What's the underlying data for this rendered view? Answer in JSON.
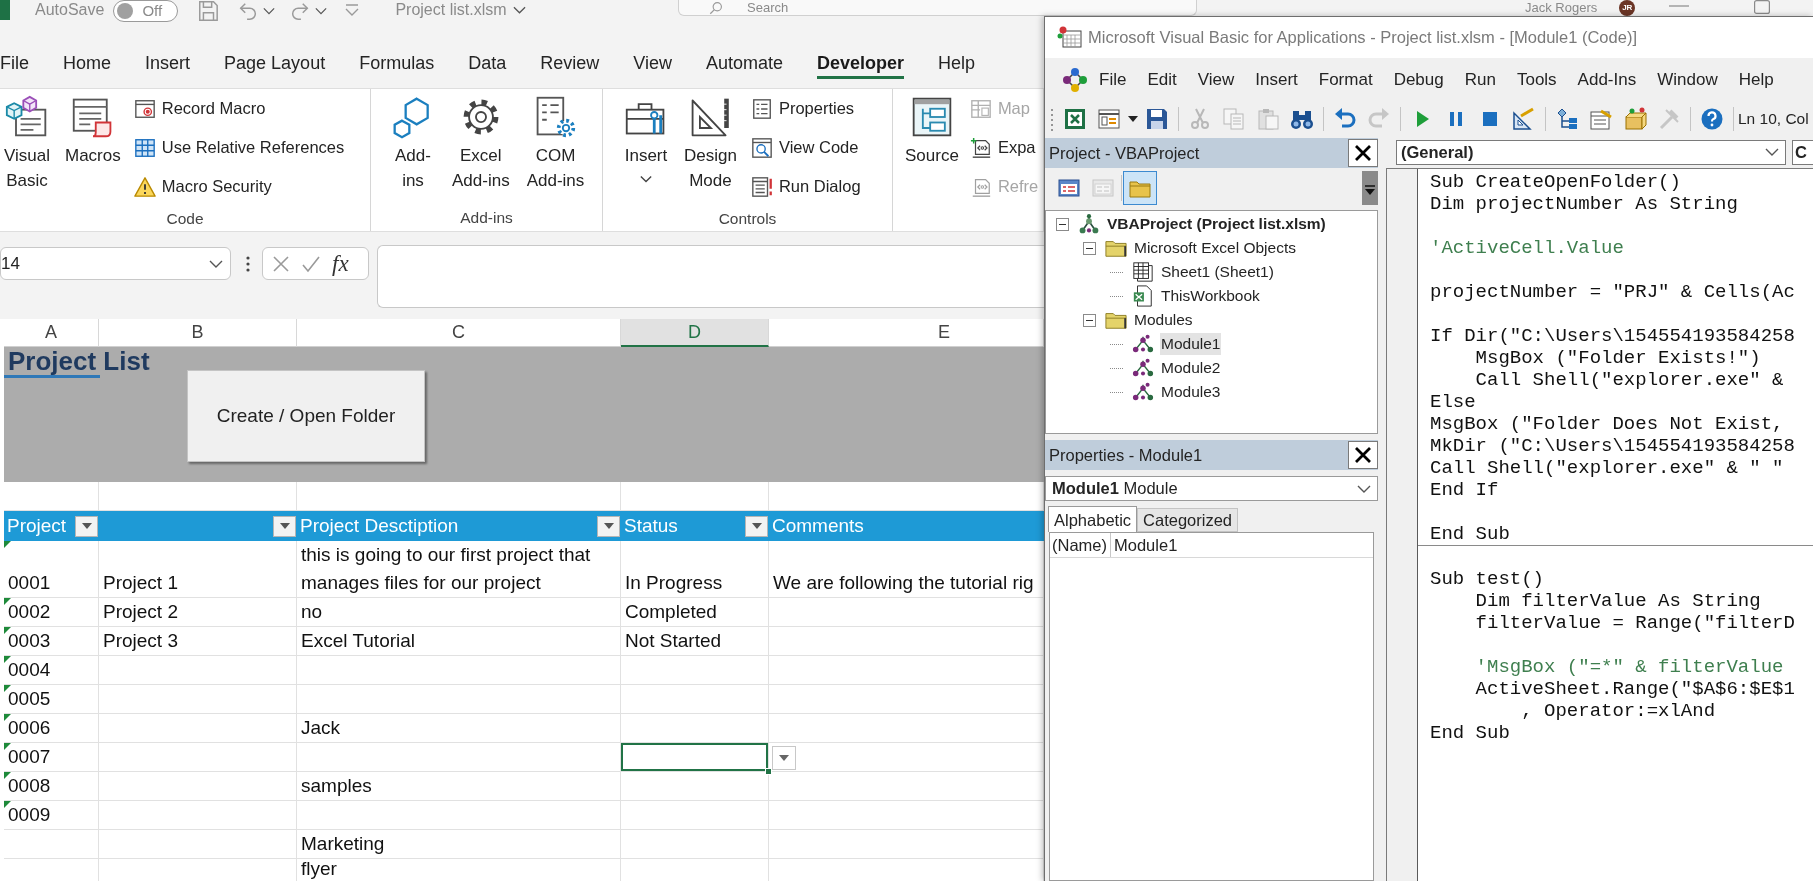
{
  "excel": {
    "title_bar": {
      "autosave_label": "AutoSave",
      "autosave": {
        "label": "Off",
        "on": false
      },
      "file_name": "Project list.xlsm",
      "search_placeholder": "Search",
      "user_name": "Jack Rogers",
      "user_initials": "JR"
    },
    "ribbon_tabs": [
      {
        "label": "File",
        "selected": false
      },
      {
        "label": "Home",
        "selected": false
      },
      {
        "label": "Insert",
        "selected": false
      },
      {
        "label": "Page Layout",
        "selected": false
      },
      {
        "label": "Formulas",
        "selected": false
      },
      {
        "label": "Data",
        "selected": false
      },
      {
        "label": "Review",
        "selected": false
      },
      {
        "label": "View",
        "selected": false
      },
      {
        "label": "Automate",
        "selected": false
      },
      {
        "label": "Developer",
        "selected": true
      },
      {
        "label": "Help",
        "selected": false
      }
    ],
    "ribbon_groups": [
      {
        "label": "Code",
        "items": [
          {
            "kind": "large",
            "label_lines": [
              "Visual",
              "Basic"
            ],
            "dropdown": false
          },
          {
            "kind": "large",
            "label_lines": [
              "Macros"
            ],
            "dropdown": false
          },
          {
            "kind": "small_stack",
            "entries": [
              {
                "label": "Record Macro",
                "disabled": false
              },
              {
                "label": "Use Relative References",
                "disabled": false
              },
              {
                "label": "Macro Security",
                "disabled": false
              }
            ]
          }
        ]
      },
      {
        "label": "Add-ins",
        "items": [
          {
            "kind": "large",
            "label_lines": [
              "Add-",
              "ins"
            ],
            "dropdown": false
          },
          {
            "kind": "large",
            "label_lines": [
              "Excel",
              "Add-ins"
            ],
            "dropdown": false
          },
          {
            "kind": "large",
            "label_lines": [
              "COM",
              "Add-ins"
            ],
            "dropdown": false
          }
        ]
      },
      {
        "label": "Controls",
        "items": [
          {
            "kind": "large",
            "label_lines": [
              "Insert"
            ],
            "dropdown": true
          },
          {
            "kind": "large",
            "label_lines": [
              "Design",
              "Mode"
            ],
            "dropdown": false
          },
          {
            "kind": "small_stack",
            "entries": [
              {
                "label": "Properties",
                "disabled": false
              },
              {
                "label": "View Code",
                "disabled": false
              },
              {
                "label": "Run Dialog",
                "disabled": false
              }
            ]
          }
        ]
      },
      {
        "items": [
          {
            "kind": "large",
            "label_lines": [
              "Source"
            ],
            "dropdown": false
          },
          {
            "kind": "small_stack",
            "entries": [
              {
                "label": "Map",
                "disabled": true
              },
              {
                "label": "Expa",
                "disabled": false
              },
              {
                "label": "Refre",
                "disabled": true
              }
            ]
          }
        ]
      }
    ],
    "formula_bar": {
      "name_box": "14",
      "function_label": "fx"
    },
    "columns": [
      {
        "label": "A",
        "selected": false
      },
      {
        "label": "B",
        "selected": false
      },
      {
        "label": "C",
        "selected": false
      },
      {
        "label": "D",
        "selected": true
      },
      {
        "label": "E",
        "selected": false
      }
    ],
    "sheet": {
      "title": "Project List",
      "button": "Create / Open Folder",
      "table": {
        "headers": [
          {
            "label": "Project",
            "filter": true
          },
          {
            "filter": true
          },
          {
            "label": "Project Desctiption",
            "filter": true
          },
          {
            "label": "Status",
            "filter": true
          },
          {
            "label": "Comments",
            "filter": false
          }
        ],
        "rows": [
          {
            "flagged": true,
            "cells": [
              {
                "text": "0001",
                "selected": false
              },
              {
                "text": "Project 1",
                "selected": false
              },
              {
                "text": "this is going to our first project that manages files for our project",
                "selected": false
              },
              {
                "text": "In Progress",
                "selected": false
              },
              {
                "text": "We are following the tutorial rig",
                "selected": false
              }
            ]
          },
          {
            "flagged": true,
            "cells": [
              {
                "text": "0002",
                "selected": false
              },
              {
                "text": "Project 2",
                "selected": false
              },
              {
                "text": "no",
                "selected": false
              },
              {
                "text": "Completed",
                "selected": false
              },
              {
                "selected": false
              }
            ]
          },
          {
            "flagged": true,
            "cells": [
              {
                "text": "0003",
                "selected": false
              },
              {
                "text": "Project 3",
                "selected": false
              },
              {
                "text": "Excel Tutorial",
                "selected": false
              },
              {
                "text": "Not Started",
                "selected": false
              },
              {
                "selected": false
              }
            ]
          },
          {
            "flagged": true,
            "cells": [
              {
                "text": "0004",
                "selected": false
              },
              {
                "selected": false
              },
              {
                "selected": false
              },
              {
                "selected": false
              },
              {
                "selected": false
              }
            ]
          },
          {
            "flagged": true,
            "cells": [
              {
                "text": "0005",
                "selected": false
              },
              {
                "selected": false
              },
              {
                "selected": false
              },
              {
                "selected": false
              },
              {
                "selected": false
              }
            ]
          },
          {
            "flagged": true,
            "cells": [
              {
                "text": "0006",
                "selected": false
              },
              {
                "selected": false
              },
              {
                "text": "Jack",
                "selected": false
              },
              {
                "selected": false
              },
              {
                "selected": false
              }
            ]
          },
          {
            "flagged": true,
            "cells": [
              {
                "text": "0007",
                "selected": false
              },
              {
                "selected": false
              },
              {
                "selected": false
              },
              {
                "selected": true
              },
              {
                "selected": false
              }
            ]
          },
          {
            "flagged": true,
            "cells": [
              {
                "text": "0008",
                "selected": false
              },
              {
                "selected": false
              },
              {
                "text": "samples",
                "selected": false
              },
              {
                "selected": false
              },
              {
                "selected": false
              }
            ]
          },
          {
            "flagged": true,
            "cells": [
              {
                "text": "0009",
                "selected": false
              },
              {
                "selected": false
              },
              {
                "selected": false
              },
              {
                "selected": false
              },
              {
                "selected": false
              }
            ]
          },
          {
            "flagged": false,
            "cells": [
              {
                "selected": false
              },
              {
                "selected": false
              },
              {
                "text": "Marketing",
                "selected": false
              },
              {
                "selected": false
              },
              {
                "selected": false
              }
            ]
          },
          {
            "flagged": false,
            "cells": [
              {
                "selected": false
              },
              {
                "selected": false
              },
              {
                "text": "flyer",
                "selected": false
              },
              {
                "selected": false
              },
              {
                "selected": false
              }
            ]
          }
        ]
      }
    }
  },
  "vba": {
    "title": "Microsoft Visual Basic for Applications - Project list.xlsm - [Module1 (Code)]",
    "menu": [
      "File",
      "Edit",
      "View",
      "Insert",
      "Format",
      "Debug",
      "Run",
      "Tools",
      "Add-Ins",
      "Window",
      "Help"
    ],
    "toolbar": [
      {
        "kind": "button",
        "disabled": false
      },
      {
        "kind": "button",
        "disabled": false
      },
      {
        "kind": "dropdown"
      },
      {
        "kind": "button",
        "disabled": false
      },
      {
        "kind": "separator"
      },
      {
        "kind": "button",
        "disabled": true
      },
      {
        "kind": "button",
        "disabled": true
      },
      {
        "kind": "button",
        "disabled": true
      },
      {
        "kind": "button",
        "disabled": false
      },
      {
        "kind": "separator"
      },
      {
        "kind": "button",
        "disabled": false
      },
      {
        "kind": "button",
        "disabled": true
      },
      {
        "kind": "separator"
      },
      {
        "kind": "button",
        "disabled": false
      },
      {
        "kind": "button",
        "disabled": false
      },
      {
        "kind": "button",
        "disabled": false
      },
      {
        "kind": "button",
        "disabled": false
      },
      {
        "kind": "separator"
      },
      {
        "kind": "button",
        "disabled": false
      },
      {
        "kind": "button",
        "disabled": false
      },
      {
        "kind": "button",
        "disabled": false
      },
      {
        "kind": "button",
        "disabled": true
      },
      {
        "kind": "separator"
      },
      {
        "kind": "button",
        "disabled": false
      },
      {
        "kind": "separator"
      }
    ],
    "position": "Ln 10, Col",
    "project": {
      "title": "Project - VBAProject",
      "tools": [
        {
          "pressed": false,
          "disabled": false
        },
        {
          "pressed": false,
          "disabled": true
        },
        {
          "pressed": true,
          "disabled": false
        }
      ],
      "tree": [
        {
          "kind": "project",
          "label": "VBAProject (Project list.xlsm)",
          "expanded": true,
          "selected": false,
          "children": [
            {
              "kind": "folder",
              "label": "Microsoft Excel Objects",
              "expanded": true,
              "selected": false,
              "children": [
                {
                  "kind": "sheet",
                  "label": "Sheet1 (Sheet1)",
                  "selected": false
                },
                {
                  "kind": "workbook",
                  "label": "ThisWorkbook",
                  "selected": false
                }
              ]
            },
            {
              "kind": "folder",
              "label": "Modules",
              "expanded": true,
              "selected": false,
              "children": [
                {
                  "kind": "module",
                  "label": "Module1",
                  "selected": true
                },
                {
                  "kind": "module",
                  "label": "Module2",
                  "selected": false
                },
                {
                  "kind": "module",
                  "label": "Module3",
                  "selected": false
                }
              ]
            }
          ]
        }
      ]
    },
    "properties": {
      "title": "Properties - Module1",
      "object": "**Module1** Module",
      "tabs": [
        {
          "label": "Alphabetic",
          "selected": true
        },
        {
          "label": "Categorized",
          "selected": false
        }
      ],
      "rows": [
        {
          "name": "(Name)",
          "value": "Module1"
        }
      ]
    },
    "code": {
      "object_box": "(General)",
      "procedure_box": "C",
      "procedures": [
        {
          "lines": [
            {
              "kind": "code",
              "text": "Sub CreateOpenFolder()"
            },
            {
              "kind": "code",
              "text": "Dim projectNumber As String"
            },
            {
              "kind": "blank"
            },
            {
              "kind": "comment",
              "text": "'ActiveCell.Value"
            },
            {
              "kind": "blank"
            },
            {
              "kind": "code",
              "text": "projectNumber = \"PRJ\" & Cells(Ac"
            },
            {
              "kind": "blank"
            },
            {
              "kind": "code",
              "text": "If Dir(\"C:\\Users\\154554193584258"
            },
            {
              "kind": "code",
              "text": "    MsgBox (\"Folder Exists!\")"
            },
            {
              "kind": "code",
              "text": "    Call Shell(\"explorer.exe\" &"
            },
            {
              "kind": "code",
              "text": "Else"
            },
            {
              "kind": "code",
              "text": "MsgBox (\"Folder Does Not Exist,"
            },
            {
              "kind": "code",
              "text": "MkDir (\"C:\\Users\\154554193584258"
            },
            {
              "kind": "code",
              "text": "Call Shell(\"explorer.exe\" & \" \""
            },
            {
              "kind": "code",
              "text": "End If"
            },
            {
              "kind": "blank"
            },
            {
              "kind": "code",
              "text": "End Sub"
            }
          ]
        },
        {
          "lines": [
            {
              "kind": "blank"
            },
            {
              "kind": "code",
              "text": "Sub test()"
            },
            {
              "kind": "code",
              "text": "    Dim filterValue As String"
            },
            {
              "kind": "code",
              "text": "    filterValue = Range(\"filterD"
            },
            {
              "kind": "blank"
            },
            {
              "kind": "comment",
              "text": "    'MsgBox (\"=*\" & filterValue"
            },
            {
              "kind": "code",
              "text": "    ActiveSheet.Range(\"$A$6:$E$1"
            },
            {
              "kind": "code",
              "text": "        , Operator:=xlAnd"
            },
            {
              "kind": "code",
              "text": "End Sub"
            }
          ]
        }
      ]
    }
  }
}
